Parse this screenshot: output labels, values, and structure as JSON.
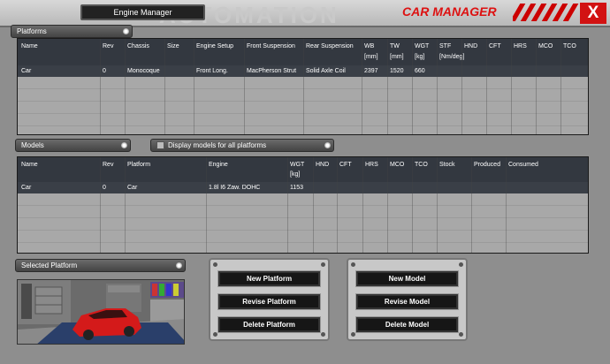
{
  "header": {
    "tab_label": "Engine Manager",
    "title": "CAR MANAGER",
    "close_glyph": "X",
    "accent_color": "#d11111"
  },
  "platforms": {
    "section_label": "Platforms",
    "columns": [
      {
        "label": "Name",
        "unit": ""
      },
      {
        "label": "Rev",
        "unit": ""
      },
      {
        "label": "Chassis",
        "unit": ""
      },
      {
        "label": "Size",
        "unit": ""
      },
      {
        "label": "Engine Setup",
        "unit": ""
      },
      {
        "label": "Front Suspension",
        "unit": ""
      },
      {
        "label": "Rear Suspension",
        "unit": ""
      },
      {
        "label": "WB",
        "unit": "[mm]"
      },
      {
        "label": "TW",
        "unit": "[mm]"
      },
      {
        "label": "WGT",
        "unit": "[kg]"
      },
      {
        "label": "STF",
        "unit": "[Nm/deg]"
      },
      {
        "label": "HND",
        "unit": ""
      },
      {
        "label": "CFT",
        "unit": ""
      },
      {
        "label": "HRS",
        "unit": ""
      },
      {
        "label": "MCO",
        "unit": ""
      },
      {
        "label": "TCO",
        "unit": ""
      }
    ],
    "rows": [
      [
        "Car",
        "0",
        "Monocoque",
        "",
        "Front Long.",
        "MacPherson Strut",
        "Solid Axle Coil",
        "2397",
        "1520",
        "660",
        "",
        "",
        "",
        "",
        "",
        ""
      ]
    ]
  },
  "models": {
    "section_label": "Models",
    "checkbox_label": "Display models for all platforms",
    "checkbox_checked": false,
    "columns": [
      {
        "label": "Name",
        "unit": ""
      },
      {
        "label": "Rev",
        "unit": ""
      },
      {
        "label": "Platform",
        "unit": ""
      },
      {
        "label": "Engine",
        "unit": ""
      },
      {
        "label": "WGT",
        "unit": "[kg]"
      },
      {
        "label": "HND",
        "unit": ""
      },
      {
        "label": "CFT",
        "unit": ""
      },
      {
        "label": "HRS",
        "unit": ""
      },
      {
        "label": "MCO",
        "unit": ""
      },
      {
        "label": "TCO",
        "unit": ""
      },
      {
        "label": "Stock",
        "unit": ""
      },
      {
        "label": "Produced",
        "unit": ""
      },
      {
        "label": "Consumed",
        "unit": ""
      }
    ],
    "rows": [
      [
        "Car",
        "0",
        "Car",
        "1.8l I6 Zaw. DOHC",
        "1153",
        "",
        "",
        "",
        "",
        "",
        "",
        "",
        ""
      ]
    ]
  },
  "selected_platform": {
    "section_label": "Selected Platform",
    "car_color": "#d41a1a"
  },
  "platform_actions": {
    "new": "New Platform",
    "revise": "Revise Platform",
    "delete": "Delete Platform"
  },
  "model_actions": {
    "new": "New Model",
    "revise": "Revise Model",
    "delete": "Delete Model"
  }
}
